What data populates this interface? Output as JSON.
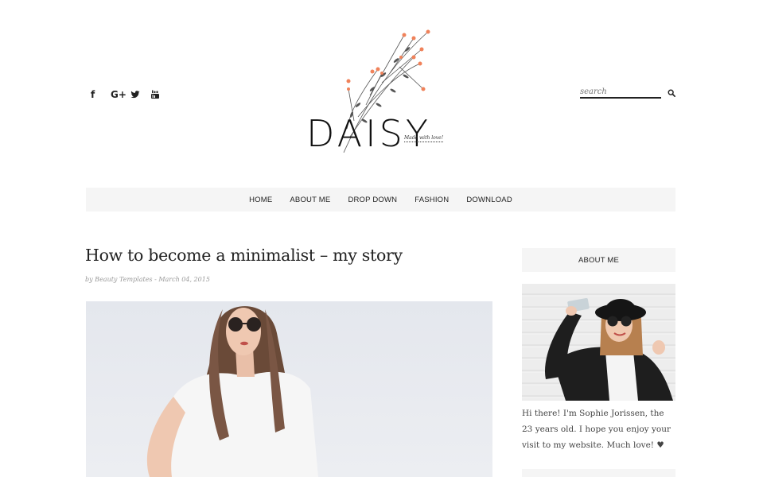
{
  "header": {
    "social_icons": [
      "facebook-icon",
      "google-plus-icon",
      "twitter-icon",
      "youtube-icon"
    ],
    "social_glyphs": [
      "f",
      "G+",
      "",
      ""
    ],
    "logo_text": "DAISY",
    "tagline": "Made with love!",
    "accent_color": "#f0825a",
    "search": {
      "placeholder": "search"
    }
  },
  "nav": {
    "items": [
      "HOME",
      "ABOUT ME",
      "DROP DOWN",
      "FASHION",
      "DOWNLOAD"
    ]
  },
  "post": {
    "title": "How to become a minimalist – my story",
    "meta": "by Beauty Templates - March 04, 2015"
  },
  "sidebar": {
    "widget_title": "ABOUT ME",
    "about_text": "Hi there! I'm Sophie Jorissen, the 23 years old. I hope you enjoy your visit to my website. Much love! ♥"
  }
}
